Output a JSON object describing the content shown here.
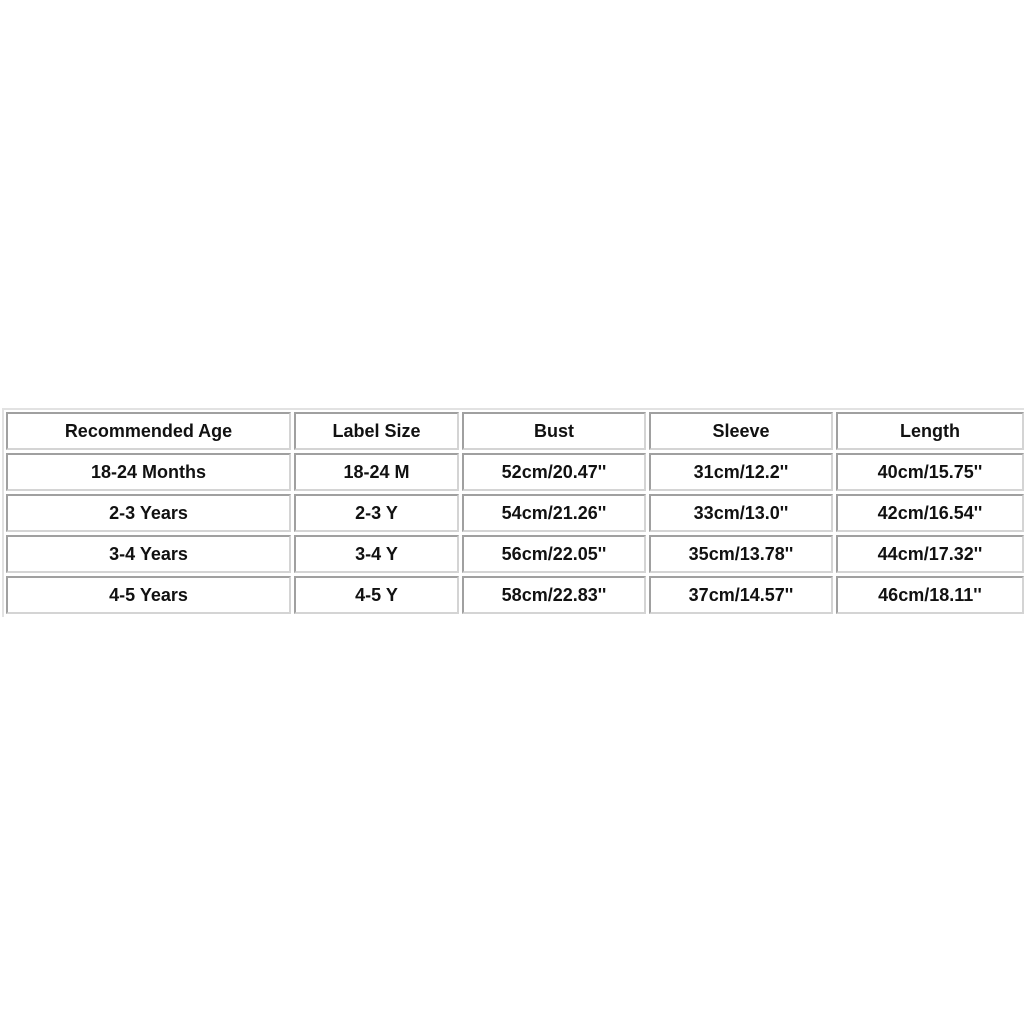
{
  "size_table": {
    "headers": [
      "Recommended Age",
      "Label Size",
      "Bust",
      "Sleeve",
      "Length"
    ],
    "rows": [
      [
        "18-24 Months",
        "18-24 M",
        "52cm/20.47''",
        "31cm/12.2''",
        "40cm/15.75''"
      ],
      [
        "2-3 Years",
        "2-3 Y",
        "54cm/21.26''",
        "33cm/13.0''",
        "42cm/16.54''"
      ],
      [
        "3-4 Years",
        "3-4 Y",
        "56cm/22.05''",
        "35cm/13.78''",
        "44cm/17.32''"
      ],
      [
        "4-5 Years",
        "4-5 Y",
        "58cm/22.83''",
        "37cm/14.57''",
        "46cm/18.11''"
      ]
    ]
  }
}
